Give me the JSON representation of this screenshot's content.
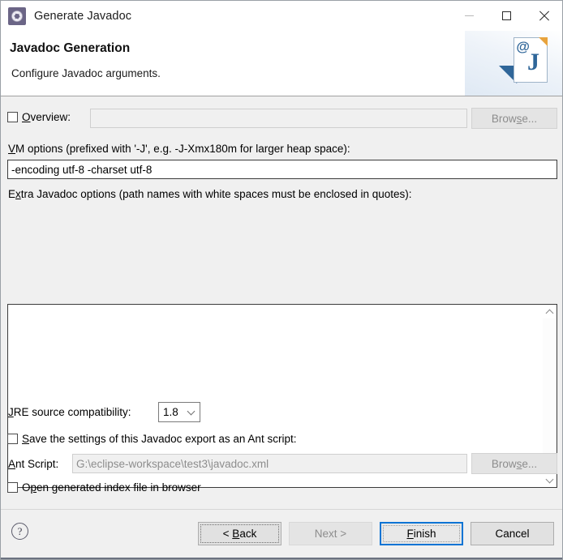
{
  "window": {
    "title": "Generate Javadoc",
    "icon": "javadoc-app-icon",
    "minimize_label": "—",
    "maximize_label": "□",
    "close_label": "✕"
  },
  "header": {
    "title": "Javadoc Generation",
    "subtitle": "Configure Javadoc arguments.",
    "banner_at": "@",
    "banner_j": "J"
  },
  "overview": {
    "label_pre": "",
    "label_mnemonic": "O",
    "label_post": "verview:",
    "checked": false,
    "value": "",
    "browse_label_pre": "Brow",
    "browse_mnemonic": "s",
    "browse_label_post": "e...",
    "enabled": false
  },
  "vm_options": {
    "label_mnemonic": "V",
    "label_post": "M options (prefixed with '-J', e.g. -J-Xmx180m for larger heap space):",
    "value": "-encoding utf-8 -charset utf-8"
  },
  "extra_options": {
    "label_pre": "E",
    "label_mnemonic": "x",
    "label_post": "tra Javadoc options (path names with white spaces must be enclosed in quotes):",
    "value": "",
    "scroll_up": "chevron-up",
    "scroll_down": "chevron-down"
  },
  "jre": {
    "label_mnemonic": "J",
    "label_post": "RE source compatibility:",
    "selected": "1.8",
    "options": [
      "1.8"
    ]
  },
  "ant_save": {
    "label_mnemonic": "S",
    "label_post": "ave the settings of this Javadoc export as an Ant script:",
    "checked": false
  },
  "ant_script": {
    "label_mnemonic": "A",
    "label_post": "nt Script:",
    "value": "G:\\eclipse-workspace\\test3\\javadoc.xml",
    "browse_label_pre": "Brow",
    "browse_mnemonic": "s",
    "browse_label_post": "e...",
    "enabled": false
  },
  "open_index": {
    "label_pre": "O",
    "label_mnemonic": "p",
    "label_post": "en generated index file in browser",
    "checked": false
  },
  "footer": {
    "help_label": "?",
    "back_pre": "< ",
    "back_mnemonic": "B",
    "back_post": "ack",
    "next_label": "Next >",
    "finish_pre": "",
    "finish_mnemonic": "F",
    "finish_post": "inish",
    "cancel_label": "Cancel"
  },
  "colors": {
    "accent_blue": "#0a74d4",
    "banner_blue": "#2f6699",
    "dialog_bg": "#f0f0f0",
    "header_bg": "#ffffff",
    "disabled_text": "#8d8d8d"
  }
}
